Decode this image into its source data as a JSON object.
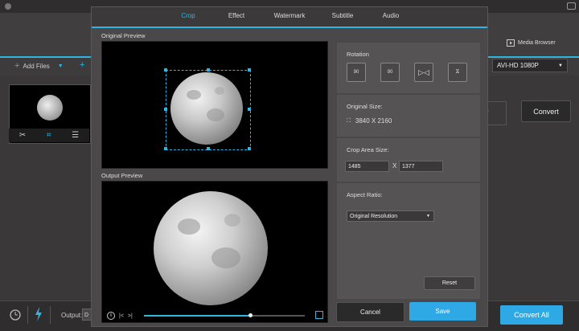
{
  "background_app": {
    "add_files_label": "Add Files",
    "media_browser_label": "Media Browser",
    "format_value": "AVI-HD 1080P",
    "convert_label": "Convert",
    "convert_all_label": "Convert All",
    "output_label": "Output:",
    "output_value": "D"
  },
  "modal": {
    "tabs": [
      "Crop",
      "Effect",
      "Watermark",
      "Subtitle",
      "Audio"
    ],
    "active_tab": "Crop",
    "original_preview_label": "Original Preview",
    "output_preview_label": "Output Preview",
    "rotation": {
      "title": "Rotation",
      "buttons": [
        "90",
        "90"
      ]
    },
    "original_size": {
      "title": "Original Size:",
      "value": "3840 X 2160"
    },
    "crop_area": {
      "title": "Crop Area Size:",
      "width": "1485",
      "separator": "X",
      "height": "1377"
    },
    "aspect_ratio": {
      "title": "Aspect Ratio:",
      "value": "Original Resolution"
    },
    "reset_label": "Reset",
    "cancel_label": "Cancel",
    "save_label": "Save",
    "player": {
      "progress": 0.66
    }
  },
  "colors": {
    "accent": "#2fb5e0",
    "save_button": "#2fa8e6"
  }
}
